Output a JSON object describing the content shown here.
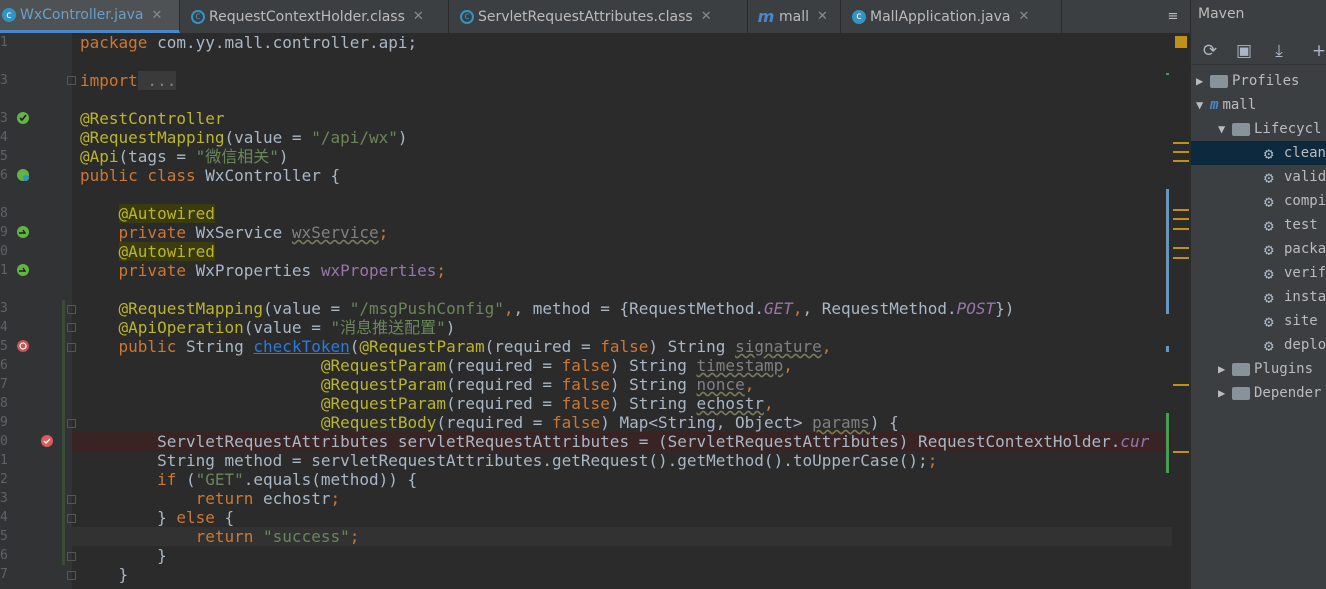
{
  "tabs": [
    {
      "label": "WxController.java",
      "icon": "class-icon",
      "active": true
    },
    {
      "label": "RequestContextHolder.class",
      "icon": "class-file-icon"
    },
    {
      "label": "ServletRequestAttributes.class",
      "icon": "class-file-icon"
    },
    {
      "label": "mall",
      "icon": "maven-icon"
    },
    {
      "label": "MallApplication.java",
      "icon": "class-icon"
    }
  ],
  "tab_menu": "≡",
  "line_numbers": [
    "1",
    "",
    "3",
    "",
    "3",
    "4",
    "5",
    "6",
    "",
    "8",
    "9",
    "0",
    "1",
    "",
    "3",
    "4",
    "5",
    "6",
    "7",
    "8",
    "9",
    "0",
    "1",
    "2",
    "3",
    "4",
    "5",
    "6",
    "7"
  ],
  "code": {
    "l1": [
      "package com.yy.mall.controller.api;"
    ],
    "l3": [
      "import",
      " ..."
    ],
    "l5a": "@RestController",
    "l5b_ann": "@RequestMapping",
    "l5b_rest": "(value = ",
    "l5b_str": "\"/api/wx\"",
    "l5b_end": ")",
    "l6_ann": "@Api",
    "l6_rest": "(tags = ",
    "l6_str": "\"微信相关\"",
    "l6_end": ")",
    "l7_kw": "public class ",
    "l7_rest": "WxController {",
    "l9_ann": "@Autowired",
    "l10_kw": "private ",
    "l10_type": "WxService ",
    "l10_fld": "wxService",
    "l10_semi": ";",
    "l11_ann": "@Autowired",
    "l12_kw": "private ",
    "l12_type": "WxProperties ",
    "l12_fld": "wxProperties",
    "l12_semi": ";",
    "l14_ann": "@RequestMapping",
    "l14_a": "(value = ",
    "l14_str": "\"/msgPushConfig\"",
    "l14_b": ", method = {RequestMethod.",
    "l14_get": "GET",
    "l14_c": ", RequestMethod.",
    "l14_post": "POST",
    "l14_d": "})",
    "l15_ann": "@ApiOperation",
    "l15_a": "(value = ",
    "l15_str": "\"消息推送配置\"",
    "l15_b": ")",
    "l16_kw": "public ",
    "l16_type": "String ",
    "l16_method": "checkToken",
    "l16_paren": "(",
    "param_ann": "@RequestParam",
    "param_a": "(required = ",
    "param_false": "false",
    "param_b": ") String ",
    "p1": "signature",
    "p2": "timestamp",
    "p3": "nonce",
    "p4": "echostr",
    "comma": ",",
    "l20_ann": "@RequestBody",
    "l20_a": "(required = ",
    "l20_false": "false",
    "l20_b": ") Map<String, Object> ",
    "l20_p": "params",
    "l20_c": ") {",
    "l21_a": "ServletRequestAttributes servletRequestAttributes = (ServletRequestAttributes) RequestContextHolder.",
    "l21_b": "cur",
    "l22": "String method = servletRequestAttributes.getRequest().getMethod().toUpperCase();",
    "l23_kw": "if ",
    "l23_a": "(",
    "l23_str": "\"GET\"",
    "l23_b": ".equals(method)) {",
    "l24_kw": "return ",
    "l24_a": "echostr",
    "l24_semi": ";",
    "l25_a": "} ",
    "l25_kw": "else ",
    "l25_b": "{",
    "l26_kw": "return ",
    "l26_str": "\"success\"",
    "l26_semi": ";",
    "l27": "}",
    "l28": "}"
  },
  "maven": {
    "title": "Maven",
    "toolbar": [
      "refresh-icon",
      "add-project-icon",
      "download-icon",
      "plus-icon"
    ],
    "tree": [
      {
        "label": "Profiles",
        "expanded": false
      },
      {
        "label": "mall",
        "expanded": true
      },
      {
        "label": "Lifecycl",
        "expanded": true
      },
      {
        "label": "clean",
        "selected": true
      },
      {
        "label": "valid"
      },
      {
        "label": "compi"
      },
      {
        "label": "test"
      },
      {
        "label": "packa"
      },
      {
        "label": "verif"
      },
      {
        "label": "insta"
      },
      {
        "label": "site"
      },
      {
        "label": "deplo"
      },
      {
        "label": "Plugins",
        "expanded": false
      },
      {
        "label": "Depender",
        "expanded": false
      }
    ]
  },
  "colors": {
    "keyword": "#cc7832",
    "annotation": "#bbb529",
    "string": "#6a8759",
    "field": "#9876aa",
    "text": "#a9b7c6",
    "accent": "#4a88c7"
  }
}
